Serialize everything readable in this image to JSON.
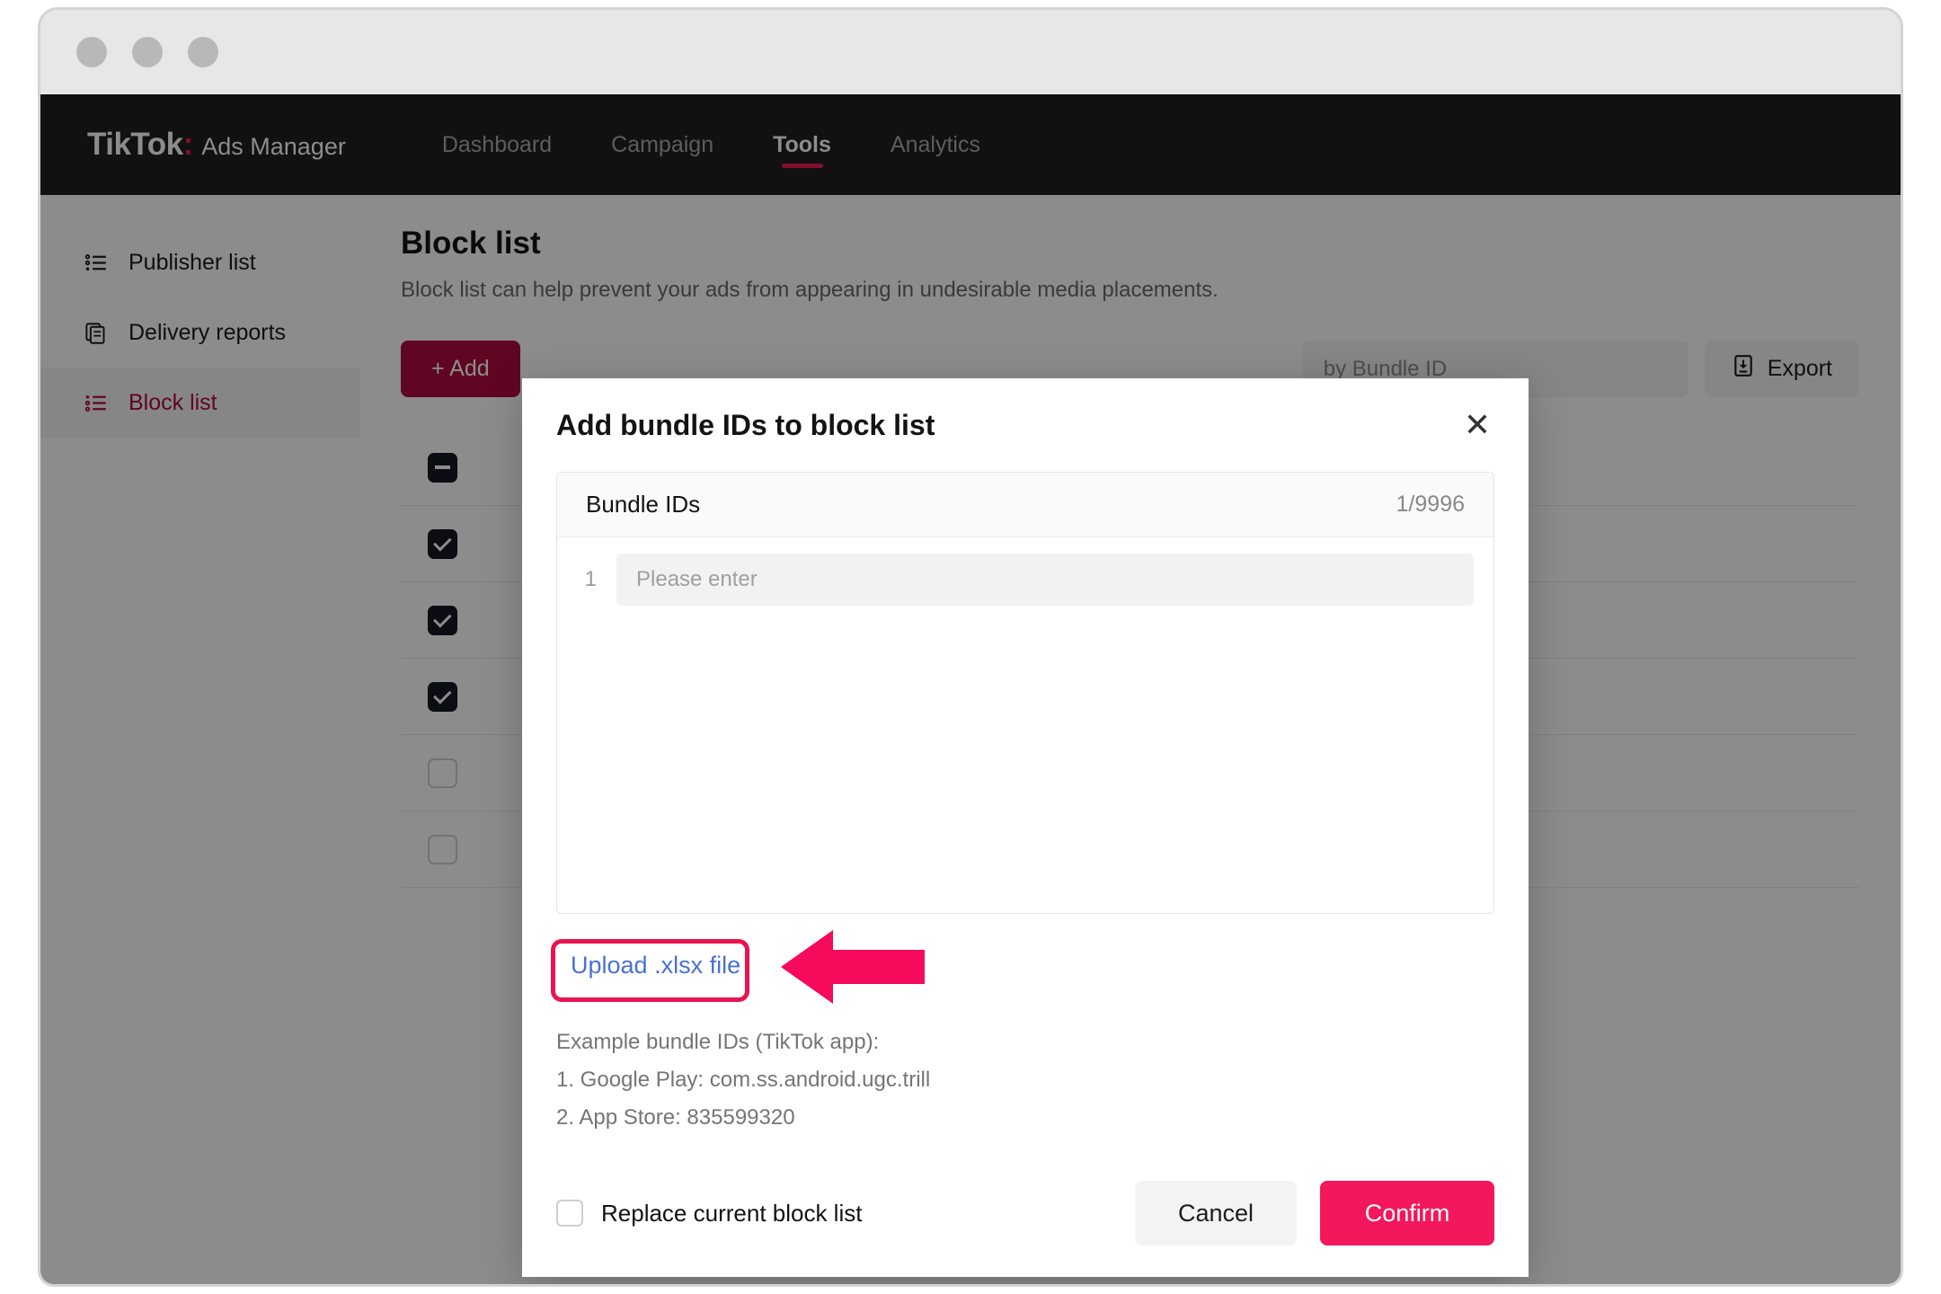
{
  "window": {
    "traffic_lights": [
      "close",
      "minimize",
      "maximize"
    ]
  },
  "topnav": {
    "brand_logo": "TikTok",
    "brand_colon": ":",
    "brand_sub": "Ads Manager",
    "items": [
      {
        "label": "Dashboard",
        "active": false
      },
      {
        "label": "Campaign",
        "active": false
      },
      {
        "label": "Tools",
        "active": true
      },
      {
        "label": "Analytics",
        "active": false
      }
    ]
  },
  "sidebar": {
    "items": [
      {
        "label": "Publisher list",
        "icon": "list-icon",
        "active": false
      },
      {
        "label": "Delivery reports",
        "icon": "document-icon",
        "active": false
      },
      {
        "label": "Block list",
        "icon": "list-icon",
        "active": true
      }
    ]
  },
  "content": {
    "title": "Block list",
    "description": "Block list can help prevent your ads from appearing in undesirable media placements.",
    "add_button": "+ Add",
    "search_placeholder": "by Bundle ID",
    "export_button": "Export",
    "export_icon": "export-file-icon",
    "table_rows": [
      {
        "checkbox": "mixed"
      },
      {
        "checkbox": "checked"
      },
      {
        "checkbox": "checked"
      },
      {
        "checkbox": "checked"
      },
      {
        "checkbox": "unchecked"
      },
      {
        "checkbox": "unchecked"
      }
    ]
  },
  "modal": {
    "title": "Add bundle IDs to block list",
    "close_icon": "close-icon",
    "panel": {
      "header_label": "Bundle IDs",
      "counter": "1/9996",
      "rows": [
        {
          "number": "1",
          "value": "",
          "placeholder": "Please enter"
        }
      ]
    },
    "upload_link": "Upload .xlsx file",
    "annotation": {
      "highlight_color": "#e8154f",
      "arrow_color": "#f50a5c",
      "arrow_direction": "left"
    },
    "examples": [
      "Example bundle IDs (TikTok app):",
      "1. Google Play: com.ss.android.ugc.trill",
      "2. App Store: 835599320"
    ],
    "replace_checkbox_label": "Replace current block list",
    "replace_checked": false,
    "cancel_button": "Cancel",
    "confirm_button": "Confirm"
  },
  "colors": {
    "brand_pink": "#ee1d52",
    "confirm_pink": "#f3185b",
    "add_dark_red": "#b00b3f",
    "link_blue": "#4b6fd6",
    "nav_dark": "#1f1f1f"
  }
}
